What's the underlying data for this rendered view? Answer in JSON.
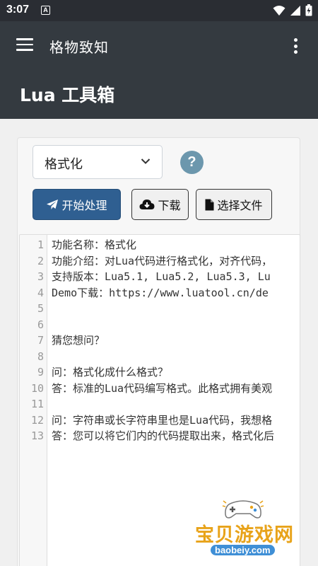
{
  "status_bar": {
    "time": "3:07",
    "notification_letter": "A"
  },
  "appbar": {
    "title": "格物致知"
  },
  "header": {
    "title": "Lua 工具箱"
  },
  "controls": {
    "select_value": "格式化",
    "help_label": "?",
    "start_label": "开始处理",
    "download_label": "下载",
    "file_label": "选择文件"
  },
  "editor": {
    "lines": [
      {
        "num": "1",
        "text": "功能名称：格式化"
      },
      {
        "num": "2",
        "text": "功能介绍：对Lua代码进行格式化，对齐代码，"
      },
      {
        "num": "3",
        "text": "支持版本：Lua5.1, Lua5.2, Lua5.3, Lu"
      },
      {
        "num": "4",
        "text": "Demo下载：https://www.luatool.cn/de"
      },
      {
        "num": "5",
        "text": ""
      },
      {
        "num": "6",
        "text": ""
      },
      {
        "num": "7",
        "text": "猜您想问？"
      },
      {
        "num": "8",
        "text": ""
      },
      {
        "num": "9",
        "text": "问：格式化成什么格式？"
      },
      {
        "num": "10",
        "text": "答：标准的Lua代码编写格式。此格式拥有美观"
      },
      {
        "num": "11",
        "text": ""
      },
      {
        "num": "12",
        "text": "问：字符串或长字符串里也是Lua代码，我想格"
      },
      {
        "num": "13",
        "text": "答：您可以将它们内的代码提取出来，格式化后"
      }
    ]
  },
  "watermark": {
    "brand": "宝贝游戏网",
    "url": "baobeiy.com"
  },
  "colors": {
    "appbar": "#343a40",
    "primary_button": "#2f5f91",
    "help": "#6c97ad"
  }
}
